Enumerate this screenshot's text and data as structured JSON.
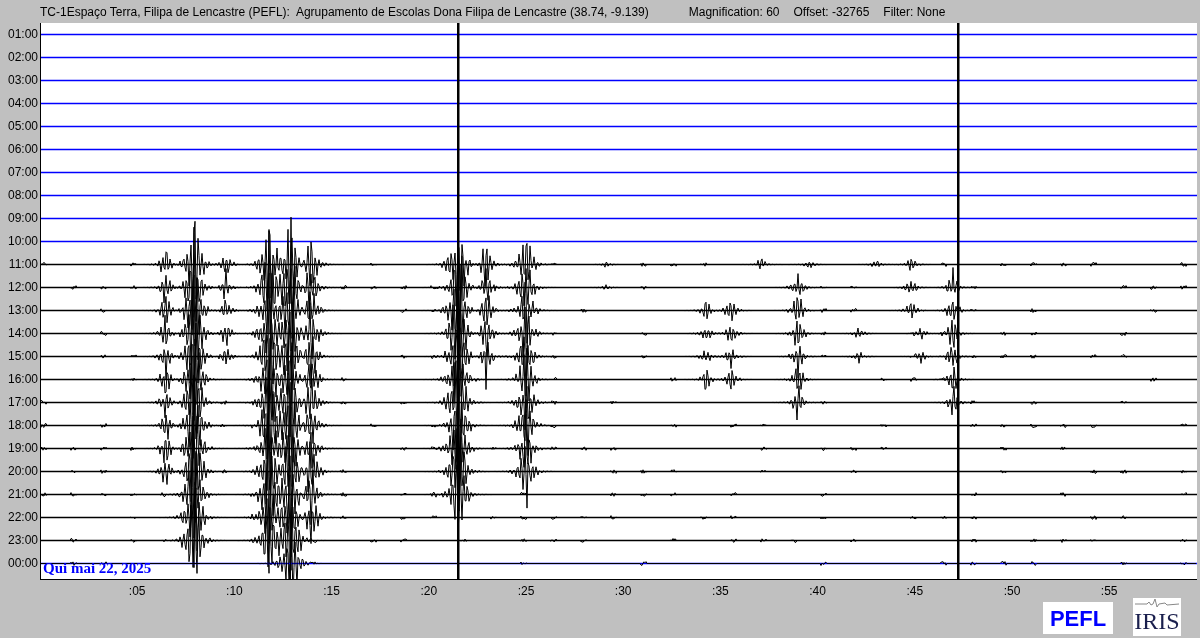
{
  "header": {
    "station": "TC-1Espaço Terra, Filipa de Lencastre (PEFL):",
    "site": "Agrupamento de Escolas Dona Filipa de Lencastre (38.74, -9.139)",
    "magnification": "Magnification: 60",
    "offset": "Offset: -32765",
    "filter": "Filter: None"
  },
  "rows": [
    {
      "label": "01:00",
      "color": "#0000ff"
    },
    {
      "label": "02:00",
      "color": "#0000ff"
    },
    {
      "label": "03:00",
      "color": "#0000ff"
    },
    {
      "label": "04:00",
      "color": "#0000ff"
    },
    {
      "label": "05:00",
      "color": "#0000ff"
    },
    {
      "label": "06:00",
      "color": "#0000ff"
    },
    {
      "label": "07:00",
      "color": "#0000ff"
    },
    {
      "label": "08:00",
      "color": "#0000ff"
    },
    {
      "label": "09:00",
      "color": "#0000ff"
    },
    {
      "label": "10:00",
      "color": "#0000ff"
    },
    {
      "label": "11:00",
      "color": "#000000"
    },
    {
      "label": "12:00",
      "color": "#000000"
    },
    {
      "label": "13:00",
      "color": "#000000"
    },
    {
      "label": "14:00",
      "color": "#000000"
    },
    {
      "label": "15:00",
      "color": "#000000"
    },
    {
      "label": "16:00",
      "color": "#000000"
    },
    {
      "label": "17:00",
      "color": "#000000"
    },
    {
      "label": "18:00",
      "color": "#000000"
    },
    {
      "label": "19:00",
      "color": "#000000"
    },
    {
      "label": "20:00",
      "color": "#000000"
    },
    {
      "label": "21:00",
      "color": "#000000"
    },
    {
      "label": "22:00",
      "color": "#000000"
    },
    {
      "label": "23:00",
      "color": "#000000"
    },
    {
      "label": "00:00",
      "color": "#0000ff"
    }
  ],
  "date_label": "Qui mai 22, 2025",
  "x_ticks": [
    ":05",
    ":10",
    ":15",
    ":20",
    ":25",
    ":30",
    ":35",
    ":40",
    ":45",
    ":50",
    ":55"
  ],
  "logos": [
    {
      "kind": "pefl",
      "text": "PEFL"
    },
    {
      "kind": "iris",
      "text": "IRIS"
    }
  ]
}
